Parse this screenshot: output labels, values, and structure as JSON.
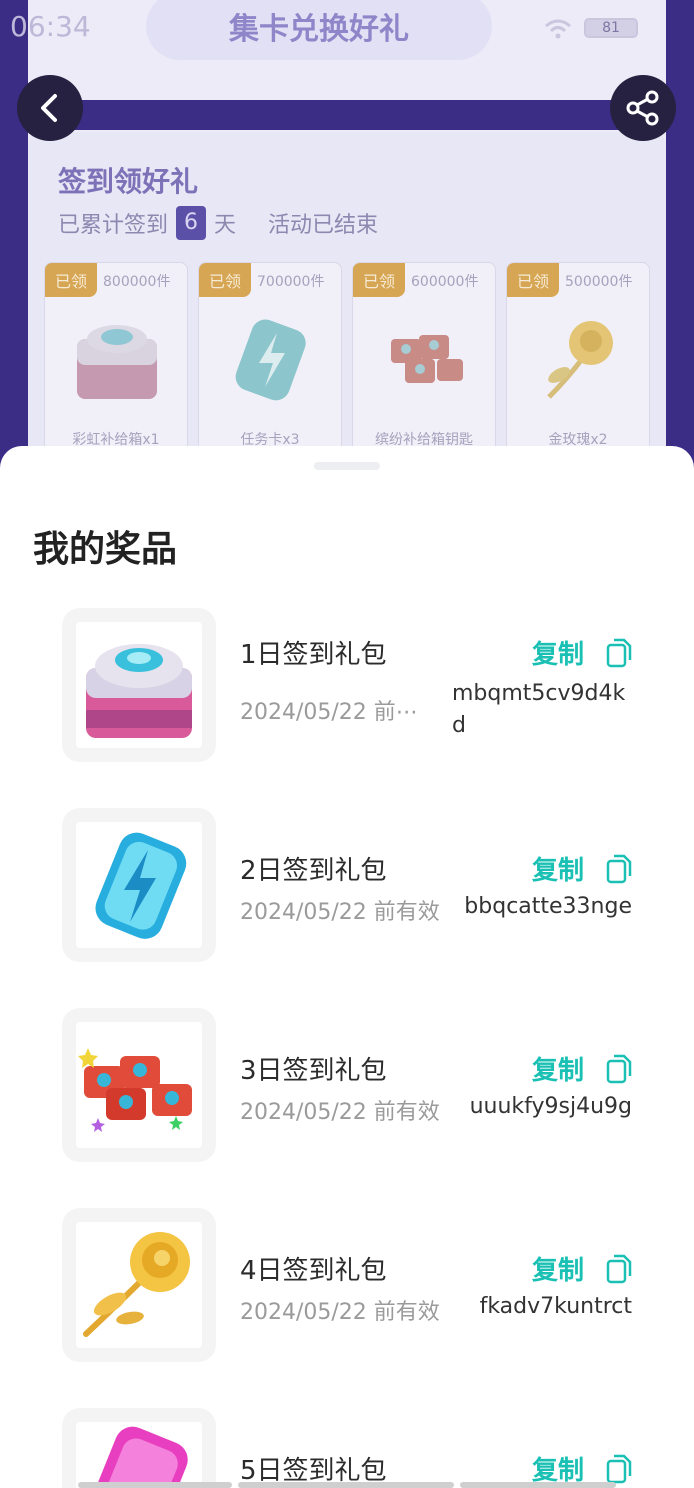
{
  "status_bar": {
    "time": "06:34",
    "battery": "81"
  },
  "header": {
    "title": "集卡兑换好礼"
  },
  "nav": {
    "back_icon": "back-arrow-icon",
    "share_icon": "share-icon"
  },
  "signin": {
    "title": "签到领好礼",
    "sub_prefix": "已累计签到",
    "days": "6",
    "sub_suffix": "天",
    "status": "活动已结束",
    "rewards": [
      {
        "tag": "已领",
        "count": "800000件",
        "name": "彩虹补给箱x1"
      },
      {
        "tag": "已领",
        "count": "700000件",
        "name": "任务卡x3"
      },
      {
        "tag": "已领",
        "count": "600000件",
        "name": "缤纷补给箱钥匙"
      },
      {
        "tag": "已领",
        "count": "500000件",
        "name": "金玫瑰x2"
      }
    ]
  },
  "sheet": {
    "title": "我的奖品",
    "copy_label": "复制",
    "items": [
      {
        "name": "1日签到礼包",
        "date": "2024/05/22 前⋯",
        "code": "mbqmt5cv9d4kd"
      },
      {
        "name": "2日签到礼包",
        "date": "2024/05/22 前有效",
        "code": "bbqcatte33nge"
      },
      {
        "name": "3日签到礼包",
        "date": "2024/05/22 前有效",
        "code": "uuukfy9sj4u9g"
      },
      {
        "name": "4日签到礼包",
        "date": "2024/05/22 前有效",
        "code": "fkadv7kuntrct"
      },
      {
        "name": "5日签到礼包",
        "date": "",
        "code": ""
      }
    ]
  },
  "colors": {
    "accent": "#19c0b3",
    "brand_purple": "#3b2d86",
    "tag_gold": "#d7a654"
  }
}
